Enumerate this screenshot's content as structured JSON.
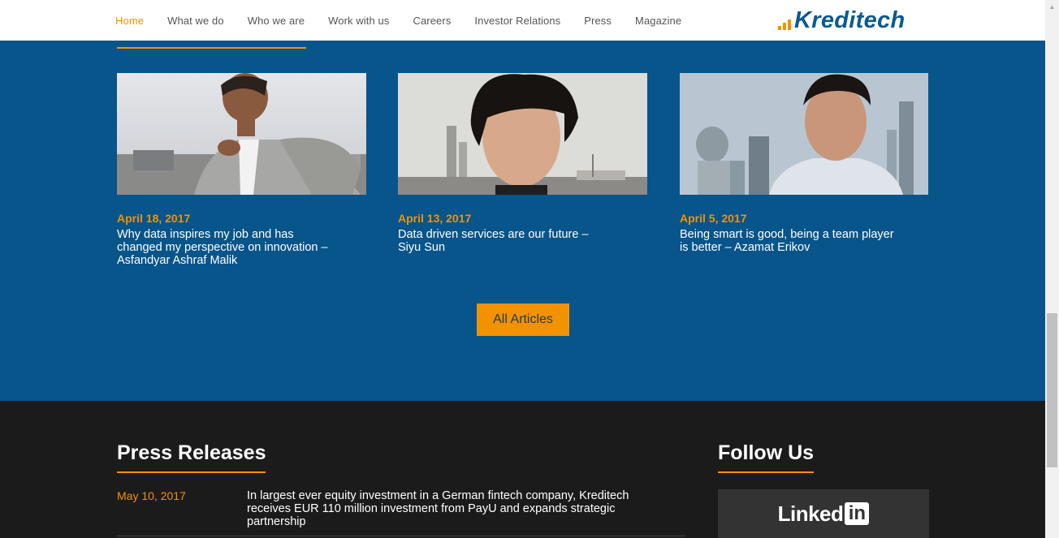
{
  "nav": {
    "items": [
      {
        "label": "Home",
        "active": true
      },
      {
        "label": "What we do",
        "active": false
      },
      {
        "label": "Who we are",
        "active": false
      },
      {
        "label": "Work with us",
        "active": false
      },
      {
        "label": "Careers",
        "active": false
      },
      {
        "label": "Investor Relations",
        "active": false
      },
      {
        "label": "Press",
        "active": false
      },
      {
        "label": "Magazine",
        "active": false
      }
    ],
    "logo_text": "Kreditech"
  },
  "articles": [
    {
      "date": "April 18, 2017",
      "title": "Why data inspires my job and has changed my perspective on innovation – Asfandyar Ashraf Malik"
    },
    {
      "date": "April 13, 2017",
      "title": "Data driven services are our future – Siyu Sun"
    },
    {
      "date": "April 5, 2017",
      "title": "Being smart is good, being a team player is better – Azamat Erikov"
    }
  ],
  "all_articles_label": "All Articles",
  "press": {
    "heading": "Press Releases",
    "items": [
      {
        "date": "May 10, 2017",
        "title": "In largest ever equity investment in a German fintech company, Kreditech receives EUR 110 million investment from PayU and expands strategic partnership"
      }
    ]
  },
  "follow": {
    "heading": "Follow Us",
    "linkedin_text": "Linked",
    "linkedin_box": "in"
  },
  "colors": {
    "accent": "#f39200",
    "brand_blue": "#07558a",
    "dark_bg": "#1c1b1b"
  }
}
